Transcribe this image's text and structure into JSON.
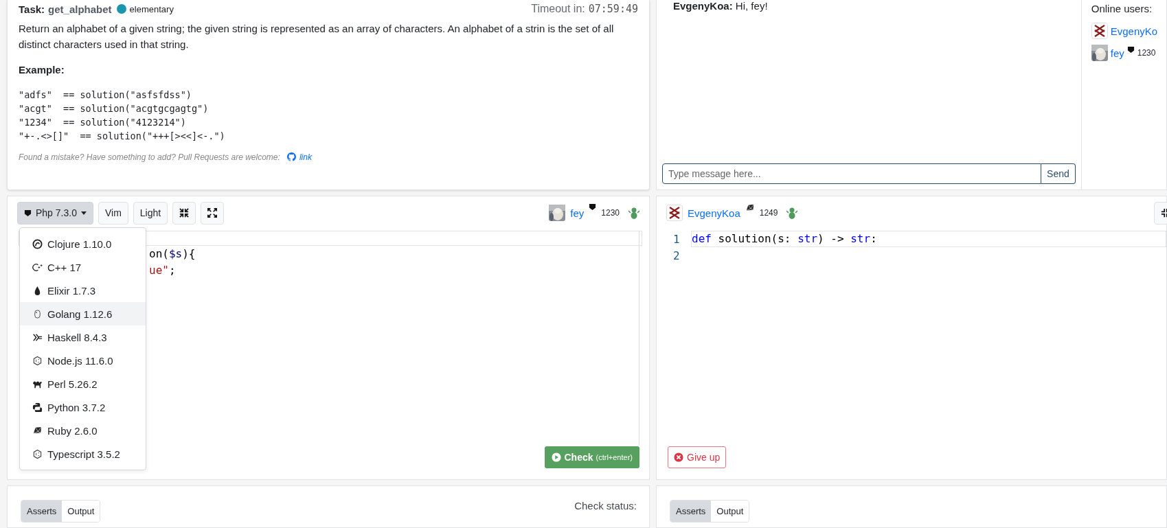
{
  "task": {
    "label": "Task:",
    "name": "get_alphabet",
    "level": "elementary",
    "timeout_label": "Timeout in:",
    "timeout": "07:59:49",
    "description": "Return an alphabet of a given string; the given string is represented as an array of characters. An alphabet of a strin is the set of all distinct characters used in that string.",
    "example_heading": "Example:",
    "examples": [
      "\"adfs\"  == solution(\"asfsfdss\")",
      "\"acgt\"  == solution(\"acgtgcgagtg\")",
      "\"1234\"  == solution(\"4123214\")",
      "\"+-.<>[]\"  == solution(\"+++[><<]<-.\")"
    ],
    "note": "Found a mistake? Have something to add? Pull Requests are welcome:",
    "link": "link"
  },
  "chat": {
    "messages": [
      "**EvgenyKoa:** Hi, fey!"
    ],
    "input": {
      "placeholder": "Type message here..."
    },
    "send": "Send"
  },
  "online_users": {
    "title": "Online users:",
    "users": [
      {
        "name": "EvgenyKo",
        "kind": "cross"
      },
      {
        "name": "fey",
        "rating": "1230"
      }
    ]
  },
  "left_editor": {
    "language": {
      "label": "Php 7.3.0",
      "expanded": true
    },
    "buttons": [
      "Vim",
      "Light"
    ],
    "player": {
      "name": "fey",
      "rating": "1230"
    },
    "code": [
      [
        {
          "text": "on(",
          "kind": "plain"
        },
        {
          "text": "$s",
          "kind": "variable"
        },
        {
          "text": "){",
          "kind": "plain"
        }
      ],
      [
        {
          "text": "ue\"",
          "kind": "string"
        },
        {
          "text": ";",
          "kind": "plain"
        }
      ]
    ],
    "languages": [
      {
        "label": "Clojure 1.10.0",
        "selected": false
      },
      {
        "label": "C++ 17",
        "selected": false
      },
      {
        "label": "Elixir 1.7.3",
        "selected": false
      },
      {
        "label": "Golang 1.12.6",
        "selected": true
      },
      {
        "label": "Haskell 8.4.3",
        "selected": false
      },
      {
        "label": "Node.js 11.6.0",
        "selected": false
      },
      {
        "label": "Perl 5.26.2",
        "selected": false
      },
      {
        "label": "Python 3.7.2",
        "selected": false
      },
      {
        "label": "Ruby 2.6.0",
        "selected": false
      },
      {
        "label": "Typescript 3.5.2",
        "selected": false
      }
    ],
    "check_button": {
      "label": "Check",
      "hint": "(ctrl+enter)"
    }
  },
  "right_editor": {
    "player": {
      "name": "EvgenyKoa",
      "rating": "1249"
    },
    "code": [
      {
        "number": "1",
        "active": true,
        "tokens": [
          {
            "text": "def",
            "kind": "keyword"
          },
          {
            "text": " solution(s: ",
            "kind": "plain"
          },
          {
            "text": "str",
            "kind": "keyword"
          },
          {
            "text": ") -> ",
            "kind": "plain"
          },
          {
            "text": "str",
            "kind": "keyword"
          },
          {
            "text": ":",
            "kind": "plain"
          }
        ]
      },
      {
        "number": "2",
        "active": false
      }
    ],
    "give_up": "Give up"
  },
  "left_output": {
    "tabs": [
      {
        "label": "Asserts",
        "selected": true
      },
      {
        "label": "Output",
        "selected": false
      }
    ],
    "status": "Check status:"
  },
  "right_output": {
    "tabs": [
      {
        "label": "Asserts",
        "selected": true
      },
      {
        "label": "Output",
        "selected": false
      }
    ]
  }
}
